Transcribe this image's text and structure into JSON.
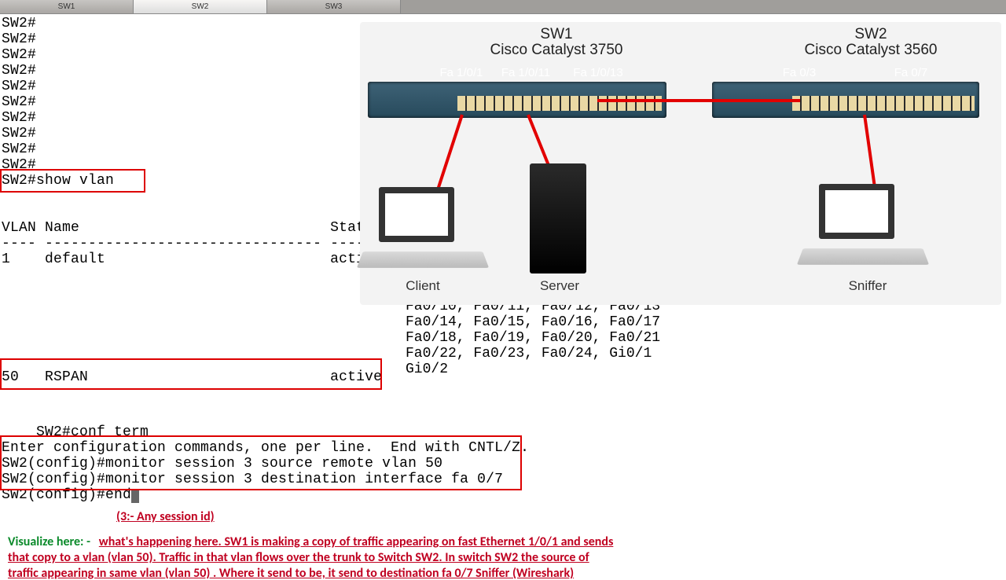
{
  "tabs": [
    {
      "label": "SW1",
      "active": false
    },
    {
      "label": "SW2",
      "active": true
    },
    {
      "label": "SW3",
      "active": false
    }
  ],
  "terminal": {
    "prompt_lines": "SW2#\nSW2#\nSW2#\nSW2#\nSW2#\nSW2#\nSW2#\nSW2#\nSW2#\nSW2#",
    "show_cmd": "SW2#show vlan",
    "header": "VLAN Name                             Status\n---- -------------------------------- ---------",
    "row_default": "1    default                          active",
    "row_rspan": "50   RSPAN                            active",
    "ports_block": "      , Fa0/2, Fa0/4, Fa0/5\n       6, Fa0/7, Fa0/8, Fa0/9\nFa0/10, Fa0/11, Fa0/12, Fa0/13\nFa0/14, Fa0/15, Fa0/16, Fa0/17\nFa0/18, Fa0/19, Fa0/20, Fa0/21\nFa0/22, Fa0/23, Fa0/24, Gi0/1\nGi0/2",
    "config_block": "SW2#conf term\nEnter configuration commands, one per line.  End with CNTL/Z.\nSW2(config)#monitor session 3 source remote vlan 50\nSW2(config)#monitor session 3 destination interface fa 0/7\nSW2(config)#end"
  },
  "diagram": {
    "sw1": {
      "title": "SW1",
      "model": "Cisco Catalyst 3750",
      "ports": [
        "Fa 1/0/1",
        "Fa 1/0/11",
        "Fa 1/0/13"
      ]
    },
    "sw2": {
      "title": "SW2",
      "model": "Cisco Catalyst 3560",
      "ports": [
        "Fa 0/3",
        "Fa 0/7"
      ]
    },
    "devices": {
      "client": "Client",
      "server": "Server",
      "sniffer": "Sniffer"
    }
  },
  "notes": {
    "session": "(3:- Any session id)",
    "visualize_label": "Visualize here: -",
    "visualize_body": " what's happening here. SW1 is making a copy of traffic appearing on fast Ethernet 1/0/1 and sends that copy to a vlan (vlan 50). Traffic in that vlan flows over the trunk to Switch SW2. In switch SW2 the source of traffic appearing in same vlan (vlan 50) . Where it send to be, it send to destination fa 0/7 Sniffer (Wireshark)"
  },
  "colors": {
    "highlight": "#d00",
    "link": "#e20000"
  }
}
